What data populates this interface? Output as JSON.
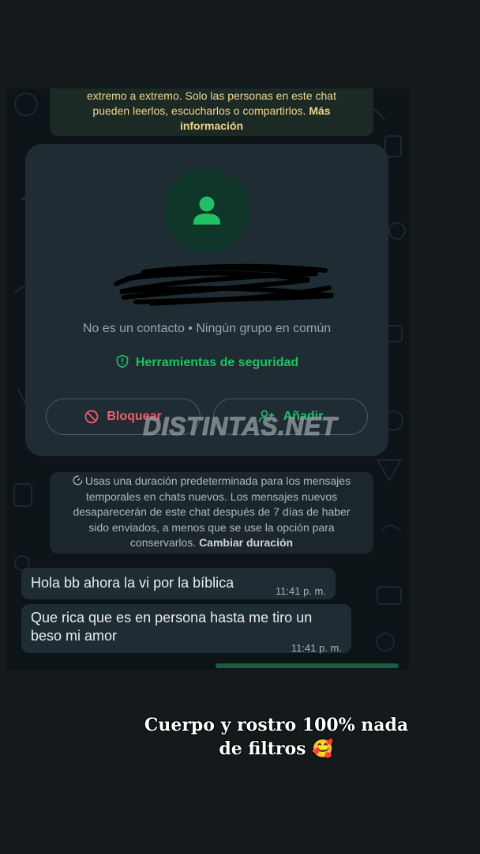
{
  "encryption_notice": {
    "line1": "extremo a extremo. Solo las personas en este chat",
    "line2": "pueden leerlos, escucharlos o compartirlos.",
    "more_link": "Más",
    "more_link2": "información"
  },
  "contact_card": {
    "contact_info": "No es un contacto • Ningún grupo en común",
    "security_tools": "Herramientas de seguridad",
    "block_label": "Bloquear",
    "add_label": "Añadir"
  },
  "watermark": "DISTINTAS.NET",
  "disappearing_notice": {
    "line1": "Usas una duración predeterminada para los mensajes",
    "line2": "temporales en chats nuevos. Los mensajes nuevos",
    "line3": "desaparecerán de este chat después de 7 días de haber",
    "line4": "sido enviados, a menos que se use la opción para",
    "line5": "conservarlos.",
    "change_link": "Cambiar duración"
  },
  "messages": [
    {
      "text": "Hola bb ahora la vi por la bíblica",
      "time": "11:41 p. m."
    },
    {
      "text_line1": "Que rica que es en persona hasta me tiro un",
      "text_line2": "beso mi amor",
      "time": "11:41 p. m."
    }
  ],
  "caption": {
    "line1": "Cuerpo y rostro 100% nada",
    "line2": "de filtros 🥰"
  },
  "colors": {
    "accent_green": "#21c063",
    "danger_red": "#f15c6d",
    "notice_yellow": "#f0d38a",
    "bubble_bg": "#1f2c33"
  }
}
